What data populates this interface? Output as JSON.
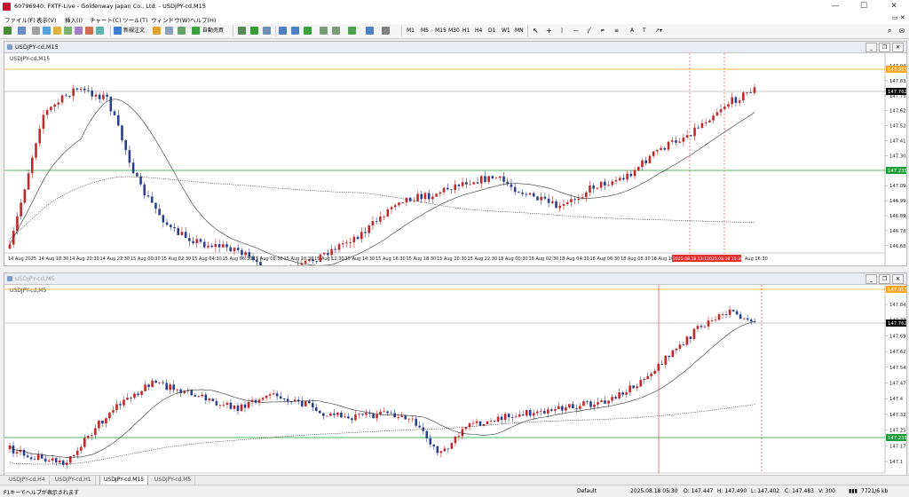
{
  "window": {
    "title": "60796940: FXTF-Live - Goldenway Japan Co., Ltd. - USDJPY-cd,M15"
  },
  "menu": [
    "ファイル(F)",
    "表示(V)",
    "挿入(I)",
    "チャート(C)",
    "ツール(T)",
    "ウィンドウ(W)",
    "ヘルプ(H)"
  ],
  "toolbar": {
    "new_order_label": "新規注文",
    "auto_trade_label": "自動売買",
    "timeframes": [
      "M1",
      "M5",
      "M15",
      "M30",
      "H1",
      "H4",
      "D1",
      "W1",
      "MN"
    ]
  },
  "chart1": {
    "title": "USDJPY-cd,M15",
    "label": "USDJPY-cd,M15",
    "price_labels": [
      147.94,
      147.835,
      147.73,
      147.625,
      147.52,
      147.41,
      147.305,
      147.2,
      147.095,
      146.995,
      146.89,
      146.785,
      146.68
    ],
    "highlight_prices": [
      {
        "value": "147.937",
        "color": "#f5a623"
      },
      {
        "value": "147.762",
        "color": "#000000"
      },
      {
        "value": "147.235",
        "color": "#1e9c3a"
      }
    ],
    "time_labels": [
      "14 Aug 2025",
      "14 Aug 18:30",
      "14 Aug 20:30",
      "14 Aug 22:30",
      "15 Aug 00:30",
      "15 Aug 02:30",
      "15 Aug 04:30",
      "15 Aug 06:30",
      "15 Aug 08:30",
      "15 Aug 10:30",
      "15 Aug 12:30",
      "15 Aug 14:30",
      "15 Aug 16:30",
      "15 Aug 18:30",
      "15 Aug 20:30",
      "15 Aug 22:30",
      "18 Aug 00:30",
      "18 Aug 02:30",
      "18 Aug 04:30",
      "18 Aug 06:30",
      "18 Aug 08:30",
      "18 Aug 10:"
    ],
    "red_time_labels": [
      "2025.08.18 13:1",
      "2025.08.18 15:30"
    ],
    "end_time_label": "Aug 16:30"
  },
  "chart2": {
    "title": "USDJPY-cd,M5",
    "label": "USDJPY-cd,M5",
    "price_labels": [
      147.845,
      147.77,
      147.695,
      147.62,
      147.545,
      147.475,
      147.4,
      147.325,
      147.25,
      147.175,
      147.1
    ],
    "highlight_prices": [
      {
        "value": "147.917",
        "color": "#f5a623"
      },
      {
        "value": "147.762",
        "color": "#000000"
      },
      {
        "value": "147.235",
        "color": "#1e9c3a"
      }
    ]
  },
  "tabs": [
    "USDJPY-cd,H4",
    "USDJPY-cd,H1",
    "USDJPY-cd,M15",
    "USDJPY-cd,M5"
  ],
  "active_tab": 2,
  "status": {
    "help": "F1キーでヘルプが表示されます",
    "profile": "Default",
    "datetime": "2025.08.18 05:30",
    "open": "O: 147.447",
    "high": "H: 147.490",
    "low": "L: 147.402",
    "close": "C: 147.483",
    "volume": "V: 300",
    "traffic": "7721/6 kb"
  }
}
